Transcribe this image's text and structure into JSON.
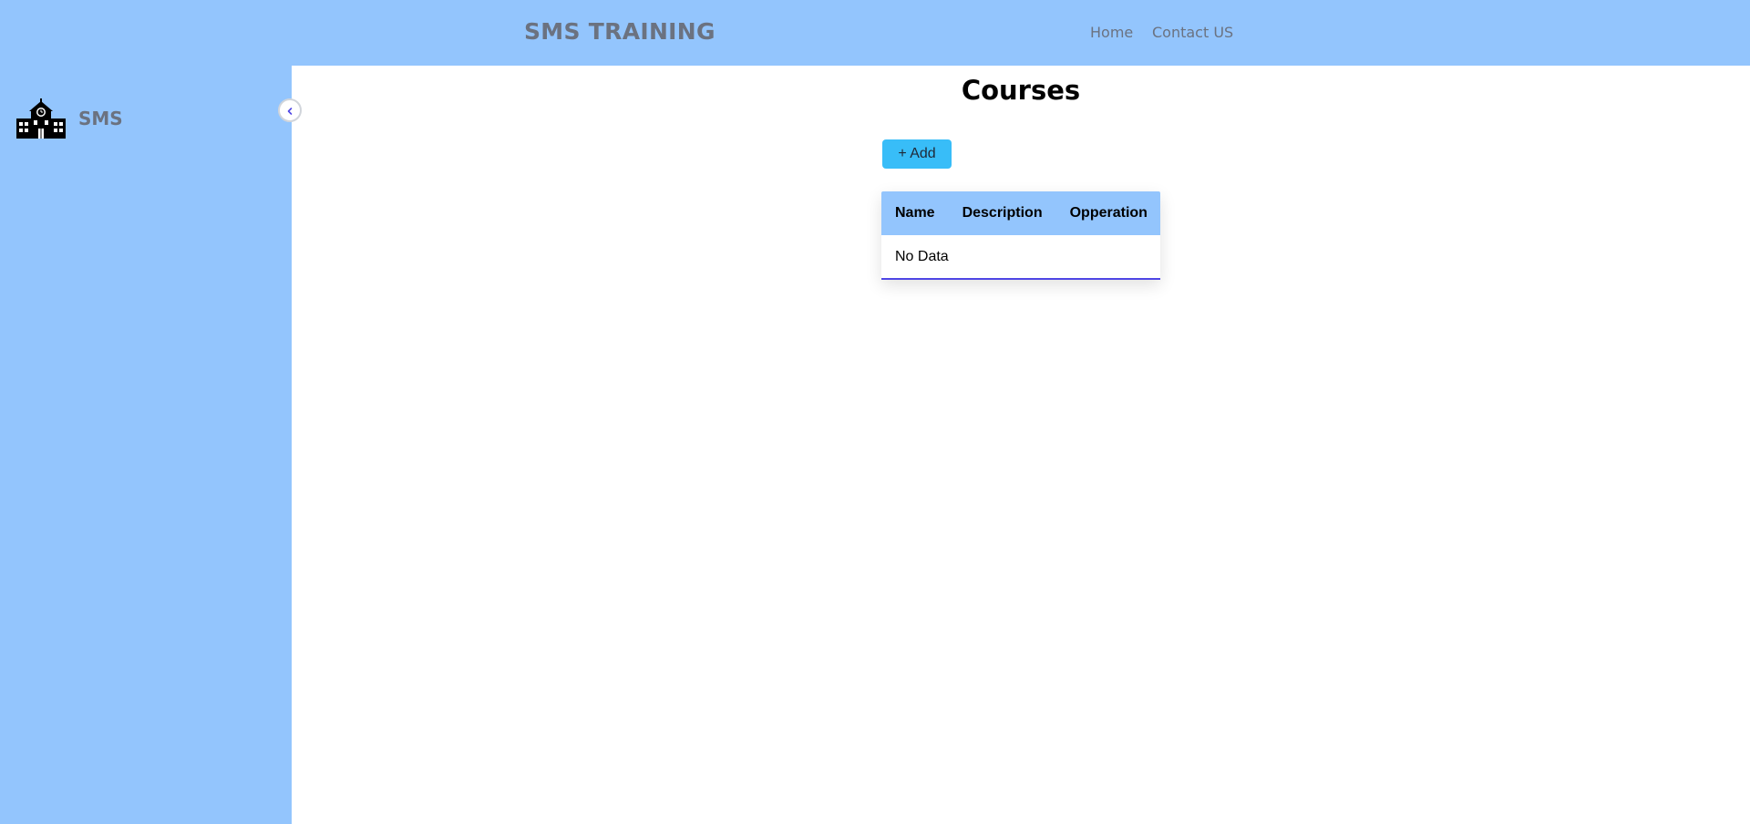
{
  "header": {
    "brand": "SMS TRAINING",
    "nav": [
      {
        "label": "Home"
      },
      {
        "label": "Contact US"
      }
    ]
  },
  "sidebar": {
    "logo_icon": "school-building-icon",
    "title": "SMS",
    "collapse_icon": "chevron-left-icon"
  },
  "main": {
    "title": "Courses",
    "add_button": "+ Add",
    "table": {
      "columns": [
        "Name",
        "Description",
        "Opperation"
      ],
      "empty_text": "No Data"
    }
  },
  "colors": {
    "header_bg": "#93c5fd",
    "sidebar_bg": "#93c5fd",
    "add_button_bg": "#38bdf8",
    "table_accent": "#4f46e5"
  }
}
